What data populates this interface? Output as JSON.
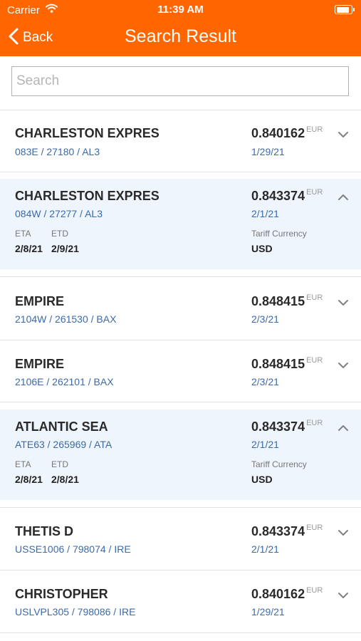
{
  "status_bar": {
    "carrier": "Carrier",
    "time": "11:39 AM"
  },
  "nav": {
    "back_label": "Back",
    "title": "Search Result"
  },
  "search": {
    "placeholder": "Search",
    "value": ""
  },
  "colors": {
    "header": "#ff6600",
    "link": "#3c6aa8",
    "expanded_bg": "#eef5fd"
  },
  "results": [
    {
      "name": "CHARLESTON EXPRES",
      "voyage": "083E / 27180 / AL3",
      "rate": "0.840162",
      "currency": "EUR",
      "date": "1/29/21",
      "expanded": false
    },
    {
      "name": "CHARLESTON EXPRES",
      "voyage": "084W / 27277 / AL3",
      "rate": "0.843374",
      "currency": "EUR",
      "date": "2/1/21",
      "expanded": true,
      "eta_label": "ETA",
      "eta": "2/8/21",
      "etd_label": "ETD",
      "etd": "2/9/21",
      "tariff_label": "Tariff Currency",
      "tariff": "USD"
    },
    {
      "name": "EMPIRE",
      "voyage": "2104W / 261530 / BAX",
      "rate": "0.848415",
      "currency": "EUR",
      "date": "2/3/21",
      "expanded": false
    },
    {
      "name": "EMPIRE",
      "voyage": "2106E / 262101 / BAX",
      "rate": "0.848415",
      "currency": "EUR",
      "date": "2/3/21",
      "expanded": false
    },
    {
      "name": "ATLANTIC SEA",
      "voyage": "ATE63 / 265969 / ATA",
      "rate": "0.843374",
      "currency": "EUR",
      "date": "2/1/21",
      "expanded": true,
      "eta_label": "ETA",
      "eta": "2/8/21",
      "etd_label": "ETD",
      "etd": "2/8/21",
      "tariff_label": "Tariff Currency",
      "tariff": "USD"
    },
    {
      "name": "THETIS D",
      "voyage": "USSE1006 / 798074 / IRE",
      "rate": "0.843374",
      "currency": "EUR",
      "date": "2/1/21",
      "expanded": false
    },
    {
      "name": "CHRISTOPHER",
      "voyage": "USLVPL305 / 798086 / IRE",
      "rate": "0.840162",
      "currency": "EUR",
      "date": "1/29/21",
      "expanded": false
    }
  ]
}
